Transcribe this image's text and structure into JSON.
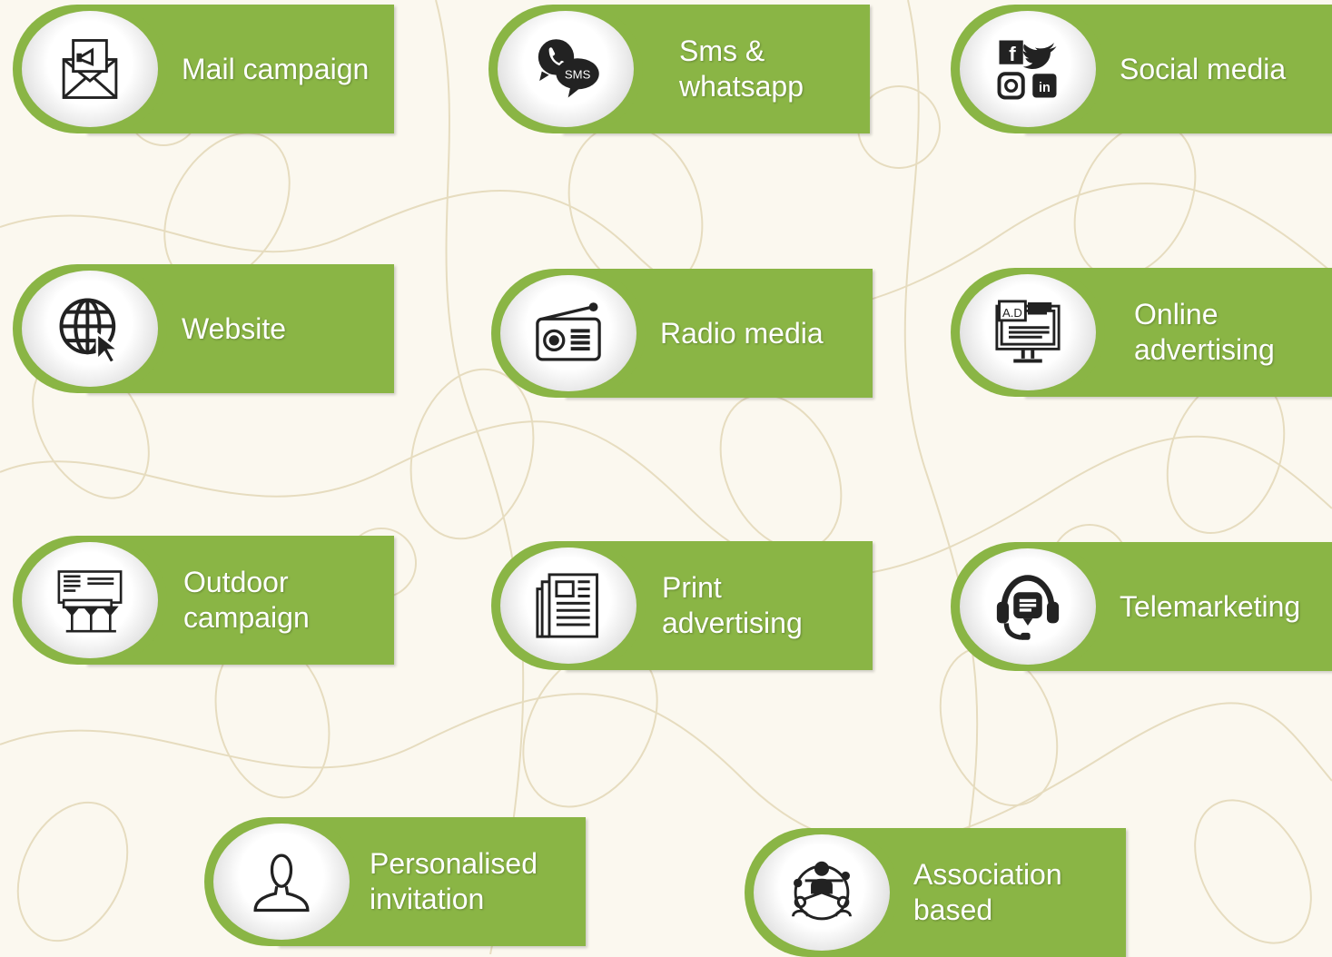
{
  "colors": {
    "card_green": "#8ab545",
    "background": "#fbf8ef",
    "text": "#ffffff",
    "icon": "#222222"
  },
  "cards": [
    {
      "label": "Mail campaign",
      "icon": "mail-megaphone-icon"
    },
    {
      "label": "Sms &\nwhatsapp",
      "icon": "whatsapp-sms-icon"
    },
    {
      "label": "Social media",
      "icon": "social-media-icon"
    },
    {
      "label": "Website",
      "icon": "globe-cursor-icon"
    },
    {
      "label": "Radio media",
      "icon": "radio-icon"
    },
    {
      "label": "Online\nadvertising",
      "icon": "online-ad-icon"
    },
    {
      "label": "Outdoor\ncampaign",
      "icon": "billboard-icon"
    },
    {
      "label": "Print\nadvertising",
      "icon": "newspaper-icon"
    },
    {
      "label": "Telemarketing",
      "icon": "headset-icon"
    },
    {
      "label": "Personalised\ninvitation",
      "icon": "person-icon"
    },
    {
      "label": "Association\nbased",
      "icon": "network-people-icon"
    }
  ],
  "social_icons": {
    "facebook": "f",
    "linkedin": "in"
  },
  "sms_badge": "SMS",
  "ad_badge": "A.D"
}
